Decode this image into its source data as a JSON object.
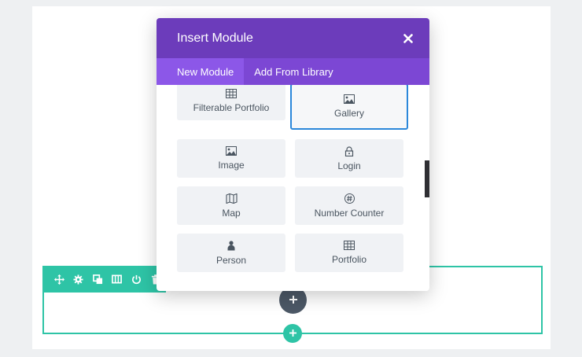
{
  "modal": {
    "title": "Insert Module",
    "close_icon": "close-icon",
    "tabs": [
      {
        "label": "New Module",
        "active": true
      },
      {
        "label": "Add From Library",
        "active": false
      }
    ],
    "modules": [
      {
        "label": "Filterable Portfolio",
        "icon": "grid-icon"
      },
      {
        "label": "Gallery",
        "icon": "image-icon",
        "selected": true
      },
      {
        "label": "Image",
        "icon": "image-icon"
      },
      {
        "label": "Login",
        "icon": "lock-icon"
      },
      {
        "label": "Map",
        "icon": "map-icon"
      },
      {
        "label": "Number Counter",
        "icon": "hash-icon"
      },
      {
        "label": "Person",
        "icon": "person-icon"
      },
      {
        "label": "Portfolio",
        "icon": "grid-icon"
      }
    ]
  },
  "row_toolbar": {
    "icons": [
      "move-icon",
      "settings-icon",
      "duplicate-icon",
      "columns-icon",
      "power-icon",
      "delete-icon"
    ]
  },
  "colors": {
    "header": "#6c3cbb",
    "tabs": "#7c47d4",
    "active_tab": "#8c57e8",
    "teal": "#2ec4a6",
    "selected_border": "#2b87da",
    "dark_button": "#4c5866"
  }
}
